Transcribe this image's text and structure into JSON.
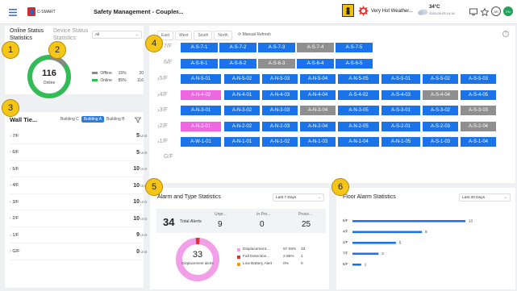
{
  "header": {
    "brand": "C-SMART",
    "title": "Safety Management - Coupler...",
    "weather_text": "Very Hot Weather...",
    "temperature": "34°C",
    "datetime": "2020-09-03 14:14",
    "user_initials_1": "AR",
    "user_initials_2": "EN"
  },
  "markers": [
    "1",
    "2",
    "3",
    "4",
    "5",
    "6"
  ],
  "status": {
    "title_1": "Online Status Statistics",
    "title_2": "Device Status Statistics",
    "select_value": "All",
    "total": "116",
    "total_label": "Online",
    "offline_pct_value": 0.15,
    "legend": [
      {
        "label": "Offline",
        "pct": "15%",
        "count": "20",
        "color": "#888888"
      },
      {
        "label": "Online",
        "pct": "85%",
        "count": "116",
        "color": "#33bb55"
      }
    ]
  },
  "wall": {
    "title": "Wall Tie...",
    "buildings": [
      "Building C",
      "Building A",
      "Building B"
    ],
    "unit_label": "Unit",
    "rows": [
      {
        "floor": "7/F",
        "count": "5"
      },
      {
        "floor": "6/F",
        "count": "5"
      },
      {
        "floor": "5/F",
        "count": "10"
      },
      {
        "floor": "4/F",
        "count": "10"
      },
      {
        "floor": "3/F",
        "count": "10"
      },
      {
        "floor": "2/F",
        "count": "10"
      },
      {
        "floor": "1/F",
        "count": "9"
      },
      {
        "floor": "G/F",
        "count": "0"
      }
    ]
  },
  "grid": {
    "tabs": [
      "East",
      "West",
      "South",
      "North"
    ],
    "refresh": "Manual Refresh",
    "floors": [
      {
        "label": "7/F",
        "rooms": [
          {
            "n": "A-S-7-1",
            "s": "b"
          },
          {
            "n": "A-S-7-2",
            "s": "b"
          },
          {
            "n": "A-S-7-3",
            "s": "b"
          },
          {
            "n": "A-S-7-4",
            "s": "g"
          },
          {
            "n": "A-S-7-5",
            "s": "b"
          }
        ]
      },
      {
        "label": "6/F",
        "rooms": [
          {
            "n": "A-S-6-1",
            "s": "b"
          },
          {
            "n": "A-S-6-2",
            "s": "b"
          },
          {
            "n": "A-S-6-3",
            "s": "g"
          },
          {
            "n": "A-S-6-4",
            "s": "b"
          },
          {
            "n": "A-S-6-5",
            "s": "b"
          }
        ]
      },
      {
        "label": "5/F",
        "rooms": [
          {
            "n": "A-N-5-01",
            "s": "b"
          },
          {
            "n": "A-N-5-02",
            "s": "b"
          },
          {
            "n": "A-N-5-03",
            "s": "b"
          },
          {
            "n": "A-N-5-04",
            "s": "b"
          },
          {
            "n": "A-N-5-05",
            "s": "b"
          },
          {
            "n": "A-S-5-01",
            "s": "b"
          },
          {
            "n": "A-S-5-02",
            "s": "b"
          },
          {
            "n": "A-S-5-03",
            "s": "b"
          }
        ]
      },
      {
        "label": "4/F",
        "rooms": [
          {
            "n": "A-N-4-02",
            "s": "p"
          },
          {
            "n": "A-N-4-01",
            "s": "b"
          },
          {
            "n": "A-N-4-03",
            "s": "b"
          },
          {
            "n": "A-N-4-04",
            "s": "b"
          },
          {
            "n": "A-S-4-02",
            "s": "b"
          },
          {
            "n": "A-S-4-03",
            "s": "b"
          },
          {
            "n": "A-S-4-04",
            "s": "g"
          },
          {
            "n": "A-S-4-05",
            "s": "b"
          }
        ]
      },
      {
        "label": "3/F",
        "rooms": [
          {
            "n": "A-N-3-01",
            "s": "b"
          },
          {
            "n": "A-N-3-02",
            "s": "b"
          },
          {
            "n": "A-N-3-03",
            "s": "b"
          },
          {
            "n": "A-N-3-04",
            "s": "g"
          },
          {
            "n": "A-N-3-05",
            "s": "b"
          },
          {
            "n": "A-S-3-01",
            "s": "b"
          },
          {
            "n": "A-S-3-02",
            "s": "b"
          },
          {
            "n": "A-S-3-03",
            "s": "g"
          }
        ]
      },
      {
        "label": "2/F",
        "rooms": [
          {
            "n": "A-N-2-01",
            "s": "p"
          },
          {
            "n": "A-N-2-02",
            "s": "b"
          },
          {
            "n": "A-N-2-03",
            "s": "b"
          },
          {
            "n": "A-N-2-04",
            "s": "b"
          },
          {
            "n": "A-N-2-05",
            "s": "b"
          },
          {
            "n": "A-S-2-01",
            "s": "b"
          },
          {
            "n": "A-S-2-03",
            "s": "b"
          },
          {
            "n": "A-S-2-04",
            "s": "g"
          }
        ]
      },
      {
        "label": "1/F",
        "rooms": [
          {
            "n": "A-W-1-01",
            "s": "b"
          },
          {
            "n": "A-N-1-01",
            "s": "b"
          },
          {
            "n": "A-N-1-02",
            "s": "b"
          },
          {
            "n": "A-N-1-03",
            "s": "b"
          },
          {
            "n": "A-N-1-04",
            "s": "b"
          },
          {
            "n": "A-N-1-05",
            "s": "b"
          },
          {
            "n": "A-S-1-03",
            "s": "b"
          },
          {
            "n": "A-S-1-04",
            "s": "b"
          }
        ]
      },
      {
        "label": "G/F",
        "rooms": []
      }
    ]
  },
  "alarm": {
    "title": "Alarm and Type Statistics",
    "range": "Last 7 Days",
    "total": "34",
    "total_label": "Total Alerts",
    "cols": [
      {
        "label": "Unpr...",
        "value": "9"
      },
      {
        "label": "In Pro...",
        "value": "0"
      },
      {
        "label": "Proce...",
        "value": "25"
      }
    ],
    "donut_value": "33",
    "donut_label": "Displacement alerts",
    "types": [
      {
        "label": "Displacement...",
        "pct": "97.05%",
        "count": "33",
        "color": "#f29ee8",
        "share": 0.9705
      },
      {
        "label": "Fall Detection...",
        "pct": "2.95%",
        "count": "1",
        "color": "#e03131",
        "share": 0.0295
      },
      {
        "label": "Low Battery Alert",
        "pct": "0%",
        "count": "0",
        "color": "#f59f00",
        "share": 0
      }
    ]
  },
  "floor_alarm": {
    "title": "Floor Alarm Statistics",
    "range": "Last 30 Days"
  },
  "chart_data": {
    "type": "bar",
    "orientation": "horizontal",
    "categories": [
      "5/F",
      "4/F",
      "2/F",
      "7/F",
      "6/F"
    ],
    "values": [
      13,
      8,
      5,
      3,
      1
    ],
    "title": "Floor Alarm Statistics",
    "color": "#1a73e8"
  }
}
